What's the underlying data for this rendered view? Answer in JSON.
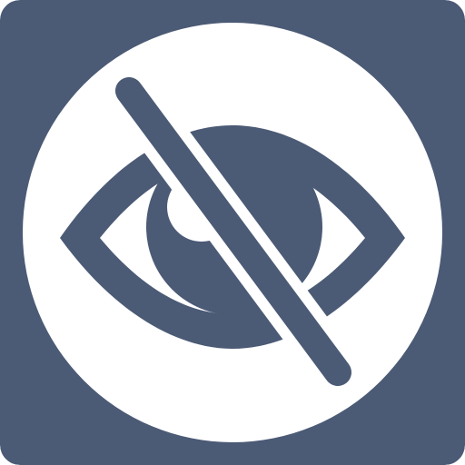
{
  "app": {
    "icon": "eye-slash-icon"
  },
  "colors": {
    "tile_background": "#4b5a75",
    "circle_fill": "#ffffff",
    "glyph": "#4b5a75",
    "highlight": "#ffffff"
  }
}
